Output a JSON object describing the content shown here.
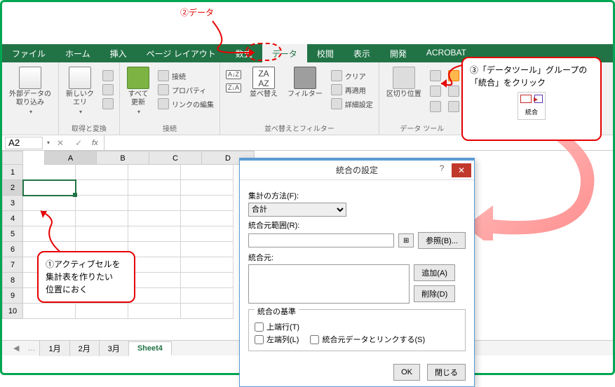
{
  "annotations": {
    "step1": "①アクティブセルを\n集計表を作りたい\n位置におく",
    "step2": "②データ",
    "step3_line1": "③「データツール」グループの",
    "step3_line2": "「統合」をクリック",
    "step3_tool": "統合"
  },
  "tabs": {
    "file": "ファイル",
    "home": "ホーム",
    "insert": "挿入",
    "pagelayout": "ページ レイアウト",
    "formulas": "数式",
    "data": "データ",
    "review": "校閲",
    "view": "表示",
    "developer": "開発",
    "acrobat": "ACROBAT"
  },
  "ribbon": {
    "get_external": "外部データの\n取り込み",
    "new_query": "新しいク\nエリ",
    "group_get": "取得と変換",
    "refresh_all": "すべて\n更新",
    "connections": "接続",
    "properties": "プロパティ",
    "edit_links": "リンクの編集",
    "group_conn": "接続",
    "sort_az_top": "A→Z",
    "sort_az_bot": "Z→A",
    "sort": "並べ替え",
    "filter": "フィルター",
    "clear": "クリア",
    "reapply": "再適用",
    "advanced": "詳細設定",
    "group_sort": "並べ替えとフィルター",
    "text_to_col": "区切り位置",
    "group_datatools": "データ ツール"
  },
  "formula": {
    "namebox": "A2",
    "fx": "fx"
  },
  "grid": {
    "cols": [
      "A",
      "B",
      "C",
      "D"
    ],
    "rows": [
      "1",
      "2",
      "3",
      "4",
      "5",
      "6",
      "7",
      "8",
      "9",
      "10"
    ]
  },
  "sheets": {
    "nav_dots": "…",
    "s1": "1月",
    "s2": "2月",
    "s3": "3月",
    "s4": "Sheet4"
  },
  "dialog": {
    "title": "統合の設定",
    "method_label": "集計の方法(F):",
    "method_value": "合計",
    "source_range_label": "統合元範囲(R):",
    "source_range_value": "",
    "browse": "参照(B)...",
    "sources_label": "統合元:",
    "add": "追加(A)",
    "delete": "削除(D)",
    "criteria_legend": "統合の基準",
    "top_row": "上端行(T)",
    "left_col": "左端列(L)",
    "link": "統合元データとリンクする(S)",
    "ok": "OK",
    "close": "閉じる"
  }
}
